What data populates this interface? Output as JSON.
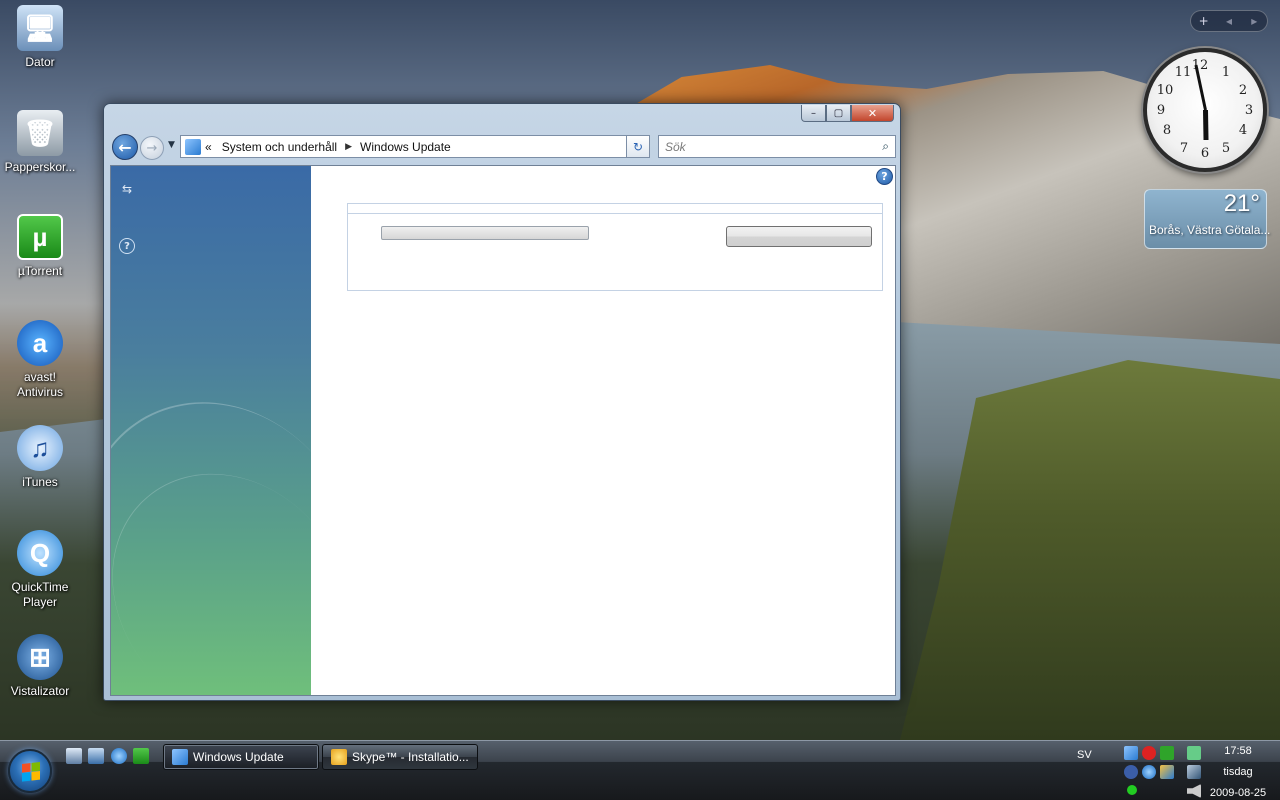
{
  "desktop": {
    "icons": [
      {
        "label": "Dator",
        "glyph": "🖥"
      },
      {
        "label": "Papperskor...",
        "glyph": "🗑"
      },
      {
        "label": "µTorrent",
        "glyph": "µ"
      },
      {
        "label": "avast! Antivirus",
        "glyph": "a"
      },
      {
        "label": "iTunes",
        "glyph": "♫"
      },
      {
        "label": "QuickTime Player",
        "glyph": "Q"
      },
      {
        "label": "Vistalizator",
        "glyph": "⊞"
      }
    ]
  },
  "window": {
    "title": "Windows Update",
    "controls": {
      "minimize": "–",
      "maximize": "▢",
      "close": "✕"
    },
    "nav": {
      "back": "←",
      "forward": "→",
      "dropdown": "▼"
    },
    "address": {
      "overflow": "«",
      "crumbs": [
        "System och underhåll",
        "Windows Update"
      ],
      "separator": "▶",
      "dropdown": "▼"
    },
    "refresh": "↻",
    "search": {
      "placeholder": "Sök",
      "icon": "search-icon"
    },
    "help": "?",
    "left_pane": {
      "sync_icon": "⇆",
      "help_icon": "?"
    },
    "panel": {
      "progress": 0,
      "button_label": ""
    }
  },
  "gadgets": {
    "controls": {
      "add": "+",
      "prev": "◂",
      "next": "▸"
    },
    "clock": {
      "numbers": [
        "12",
        "1",
        "2",
        "3",
        "4",
        "5",
        "6",
        "7",
        "8",
        "9",
        "10",
        "11"
      ],
      "hour": 5,
      "minute": 58
    },
    "weather": {
      "temperature": "21°",
      "location": "Borås, Västra Götala..."
    }
  },
  "taskbar": {
    "tasks": [
      {
        "label": "Windows Update",
        "active": true
      },
      {
        "label": "Skype™ - Installatio...",
        "active": false
      }
    ],
    "language": "SV",
    "clock": {
      "time": "17:58",
      "day": "tisdag",
      "date": "2009-08-25"
    }
  }
}
